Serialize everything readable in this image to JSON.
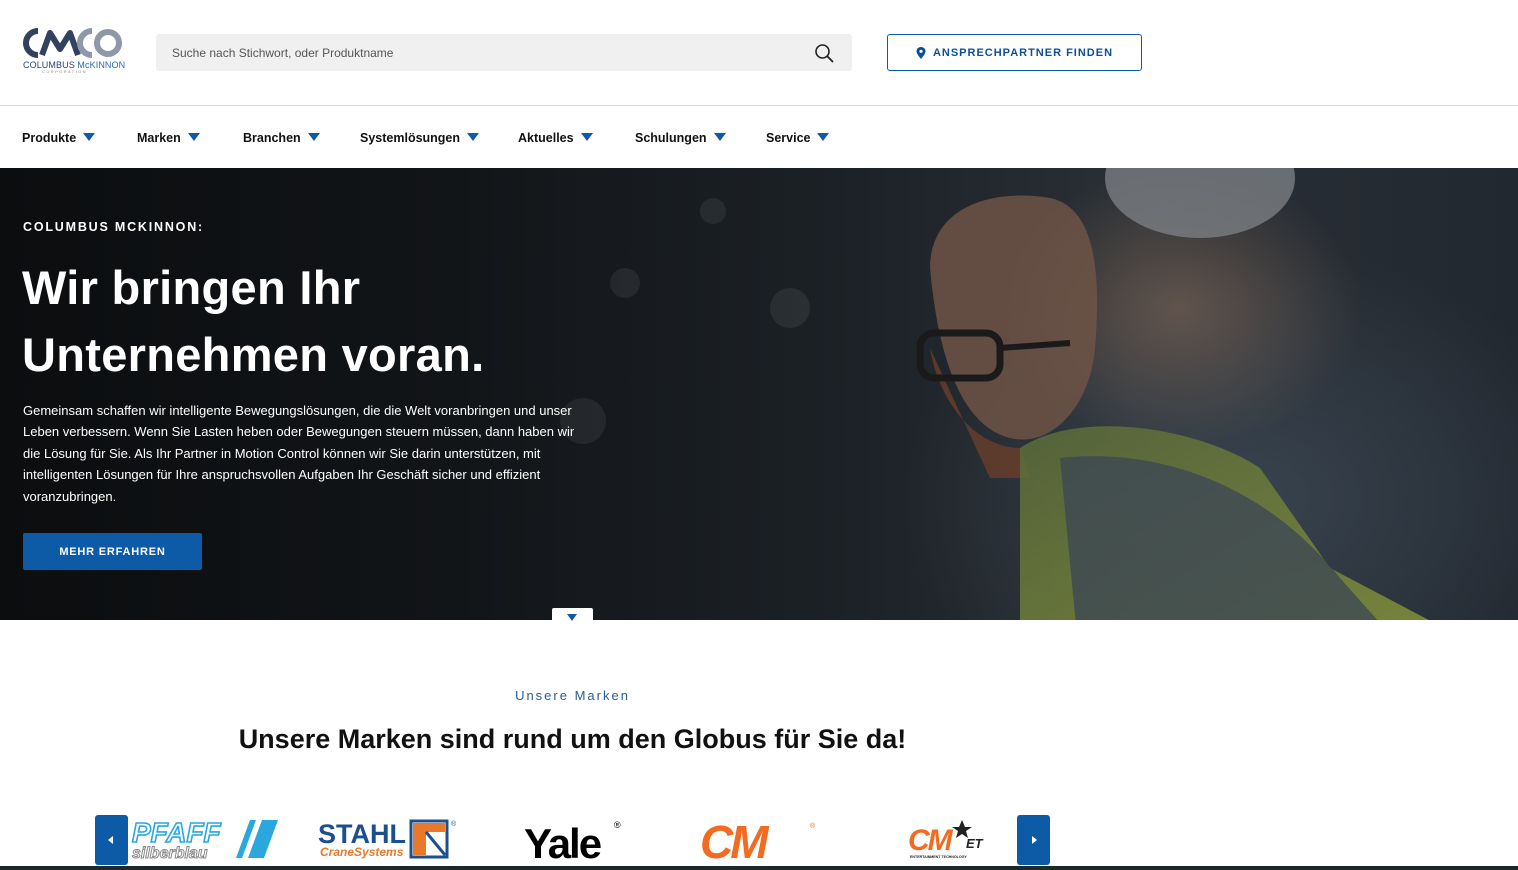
{
  "header": {
    "logo": {
      "name_main": "COLUMBUS",
      "name_accent": "McKINNON",
      "subline": "CORPORATION"
    },
    "search": {
      "placeholder": "Suche nach Stichwort, oder Produktname",
      "icon": "search-icon"
    },
    "contact_button": {
      "label": "ANSPRECHPARTNER FINDEN",
      "icon": "location-pin-icon"
    }
  },
  "nav": {
    "items": [
      {
        "label": "Produkte"
      },
      {
        "label": "Marken"
      },
      {
        "label": "Branchen"
      },
      {
        "label": "Systemlösungen"
      },
      {
        "label": "Aktuelles"
      },
      {
        "label": "Schulungen"
      },
      {
        "label": "Service"
      }
    ],
    "dropdown_icon": "caret-down-icon"
  },
  "hero": {
    "eyebrow": "COLUMBUS MCKINNON:",
    "title_line1": "Wir bringen Ihr",
    "title_line2": "Unternehmen voran.",
    "text": "Gemeinsam schaffen wir intelligente Bewegungslösungen, die die Welt voranbringen und unser Leben verbessern. Wenn Sie Lasten heben oder Bewegungen steuern müssen, dann haben wir die Lösung für Sie. Als Ihr Partner in Motion Control können wir Sie darin unterstützen, mit intelligenten Lösungen für Ihre anspruchsvollen Aufgaben Ihr Geschäft sicher und effizient voranzubringen.",
    "button_label": "MEHR ERFAHREN"
  },
  "brands": {
    "eyebrow": "Unsere Marken",
    "title": "Unsere Marken sind rund um den Globus für Sie da!",
    "logos": [
      {
        "text": "PFAFF",
        "sub": "silberblau"
      },
      {
        "text": "STAHL",
        "sub": "CraneSystems"
      },
      {
        "text": "Yale"
      },
      {
        "text": "CM"
      },
      {
        "text": "CM",
        "sub": "ENTERTAINMENT TECHNOLOGY",
        "mark": "ET"
      }
    ]
  },
  "colors": {
    "brand_blue": "#0d5aa7",
    "stahl_orange": "#e8792b",
    "cm_orange": "#f26b21"
  }
}
